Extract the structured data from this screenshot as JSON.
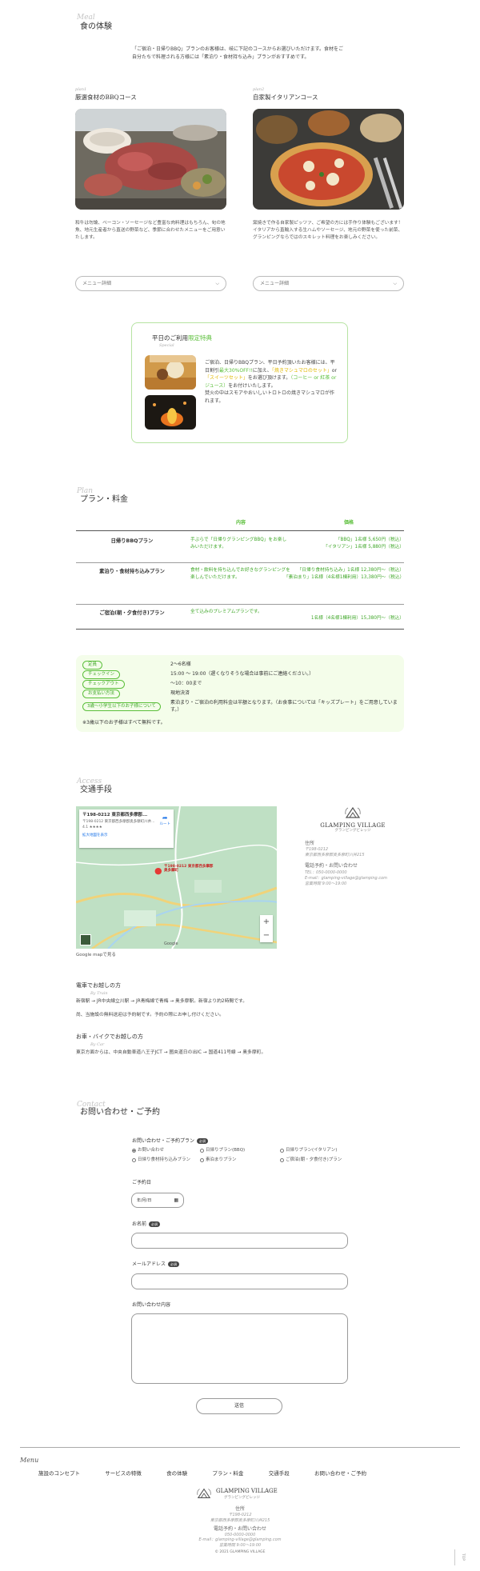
{
  "meal": {
    "en": "Meal",
    "title": "食の体験",
    "intro": "「ご宿泊・日帰りBBQ」プランのお客様は、岐に下記のコースからお選びいただけます。食材をご自分たちで料理される方様には「素泊り・食材持ち込み」プランがおすすめです。",
    "plan1": {
      "en": "plan1",
      "title": "厳選食材のBBQコース",
      "desc": "和牛は勿論、ベーコン・ソーセージなど豊富な肉料理はもちろん、旬の地魚、地元生産者から直送の野菜など、季節に合わせたメニューをご用意いたします。",
      "select": "メニュー詳細"
    },
    "plan2": {
      "en": "plan2",
      "title": "自家製イタリアンコース",
      "desc": "窯焼きで作る自家製ピッツァ、ご希望の方には手作り体験もございます！イタリアから直輸入する生ハムやソーセージ、地元の野菜を使った前菜、グランピングならではのスキレット料理をお楽しみください。",
      "select": "メニュー詳細"
    }
  },
  "special": {
    "title_a": "平日のご利用",
    "title_b": "限定特典",
    "en": "Special",
    "body_1": "ご宿泊、日帰りBBQプラン、平日予約頂いたお客様には、平日割引",
    "hl_1": "最大30%OFF!!",
    "body_2": "に加え、",
    "hl_2": "「焼きマシュマロのセット」",
    "body_3": "or",
    "hl_3": "「スイーツセット」",
    "body_4": "をお選び頂けます。",
    "hl_4": "（コーヒー or 紅茶 or ジュース）",
    "body_5": "をお付けいたします。",
    "note": "焚火の中はスモアやおいしいトロトロの焼きマシュマロが作れます。"
  },
  "plan": {
    "en": "Plan",
    "title": "プラン・料金",
    "headers": [
      "内容",
      "価格"
    ],
    "rows": [
      {
        "name": "日帰りBBQプラン",
        "content": "手ぶらで「日帰りグランピングBBQ」をお楽しみいただけます。",
        "price": [
          "「BBQ」1名様 5,650円（税込）",
          "「イタリアン」1名様 5,880円（税込）"
        ]
      },
      {
        "name": "素泊り・食材持ち込みプラン",
        "content": "食材・飲料を持ち込んでお好きなグランピングを楽しんでいただけます。",
        "price": [
          "「日帰り食材持ち込み」1名様 12,380円～（税込）",
          "「素泊まり」1名様（4名様1棟利用）13,380円～（税込）"
        ]
      },
      {
        "name": "ご宿泊(朝・夕食付き)プラン",
        "content": "全て込みのプレミアムプランです。",
        "price": [
          "1名様（4名様1棟利用）15,380円～（税込）"
        ]
      }
    ]
  },
  "info": {
    "rows": [
      {
        "tag": "定員",
        "text": "2〜6名様"
      },
      {
        "tag": "チェックイン",
        "text": "15:00 〜 19:00（遅くなりそうな場合は事前にご連絡ください。）"
      },
      {
        "tag": "チェックアウト",
        "text": "〜10：00まで"
      },
      {
        "tag": "お支払い方法",
        "text": "現地決済"
      },
      {
        "tag": "3歳〜小学生以下のお子様について",
        "text": "素泊まり・ご宿泊の利用料金は半額となります。（お食事については「キッズプレート」をご用意しています。）"
      }
    ],
    "note": "※3歳以下のお子様はすべて無料です。"
  },
  "access": {
    "en": "Access",
    "title": "交通手段",
    "map": {
      "card_title": "〒198-0212 東京都西多摩郡...",
      "card_addr": "〒198-0212 東京都西多摩郡奥多摩町川井...",
      "card_rating": "4.1 ★★★★",
      "card_link": "拡大地図を表示",
      "route": "ルート",
      "pin": "〒198-0212 東京都西多摩郡奥多摩町",
      "caption": "Google mapで見る",
      "zoom_in": "+",
      "zoom_out": "−",
      "google": "Google"
    },
    "logo": {
      "name": "GLAMPING VILLAGE",
      "kana": "グランピングビレッジ"
    },
    "addr_h": "住所",
    "zip": "〒198-0212",
    "addr": "東京都西多摩郡奥多摩町川井215",
    "tel_h": "電話予約・お問い合わせ",
    "tel": "TEL：050-0000-0000",
    "mail": "E-mail：glamping-village@glamping.com",
    "hours": "営業時間 9:00〜19:00",
    "train": {
      "title": "電車でお越しの方",
      "en": "By Train",
      "text": "新宿駅 → JR中央線立川駅 → JR青梅線で青梅 → 奥多摩駅。新宿より約2時間です。",
      "note": "尚、当施設の無料送迎は予約制です。予約の際にお申し付けください。"
    },
    "car": {
      "title": "お車・バイクでお越しの方",
      "en": "By Car",
      "text": "東京方面からは、中央自動車道八王子JCT → 圏央道日の出IC → 国道411号線 → 奥多摩町。"
    }
  },
  "contact": {
    "en": "Contact",
    "title": "お問い合わせ・ご予約",
    "q_plan": "お問い合わせ・ご予約プラン",
    "required": "必須",
    "options": [
      "お問い合わせ",
      "日帰りプラン(BBQ)",
      "日帰りプラン(イタリアン)",
      "日帰り食材持ち込みプラン",
      "素泊まりプラン",
      "ご宿泊(朝・夕食付き)プラン"
    ],
    "q_date": "ご予約日",
    "date_ph": "年/月/日",
    "q_name": "お名前",
    "q_mail": "メールアドレス",
    "q_body": "お問い合わせ内容",
    "submit": "送信"
  },
  "footer": {
    "menu": "Menu",
    "nav": [
      "施設のコンセプト",
      "サービスの特徴",
      "食の体験",
      "プラン・料金",
      "交通手段",
      "お問い合わせ・ご予約"
    ],
    "logo": {
      "name": "GLAMPING VILLAGE",
      "kana": "グランピングビレッジ"
    },
    "addr_h": "住所",
    "zip": "〒198-0212",
    "addr": "東京都西多摩郡奥多摩町川井215",
    "tel_h": "電話予約・お問い合わせ",
    "tel": "050-0000-0000",
    "mail": "E-mail：glamping-village@glamping.com",
    "hours": "営業時間 9:00〜19:00",
    "copy": "© 2021 GLAMPING VILLAGE",
    "top": "TOP"
  },
  "colors": {
    "accent": "#5bbf3a",
    "highlight": "#e9c400",
    "panel": "#f4fdea"
  }
}
